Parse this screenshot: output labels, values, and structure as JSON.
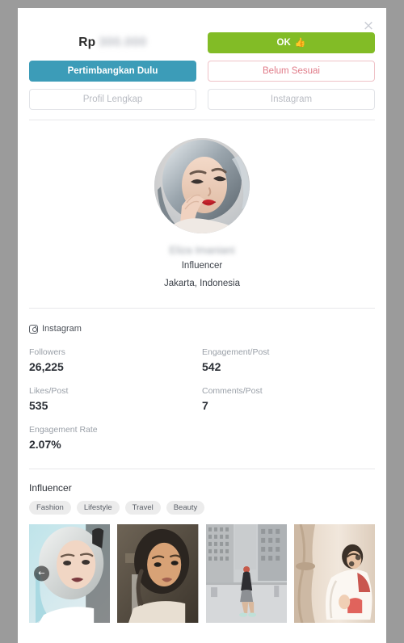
{
  "modal": {
    "close_label": "×"
  },
  "actions": {
    "price_currency": "Rp",
    "price_amount_redacted": "300.000",
    "ok_label": "OK",
    "ok_icon": "thumbs-up-icon",
    "consider_label": "Pertimbangkan Dulu",
    "reject_label": "Belum Sesuai",
    "full_profile_label": "Profil Lengkap",
    "instagram_label": "Instagram"
  },
  "profile": {
    "name_redacted": "Eliza Imaniani",
    "role": "Influencer",
    "location": "Jakarta, Indonesia",
    "avatar_alt": "influencer-portrait"
  },
  "platform": {
    "icon": "instagram-icon",
    "name": "Instagram"
  },
  "stats": [
    {
      "label": "Followers",
      "value": "26,225"
    },
    {
      "label": "Engagement/Post",
      "value": "542"
    },
    {
      "label": "Likes/Post",
      "value": "535"
    },
    {
      "label": "Comments/Post",
      "value": "7"
    },
    {
      "label": "Engagement Rate",
      "value": "2.07%"
    }
  ],
  "categories": {
    "heading": "Influencer",
    "tags": [
      "Fashion",
      "Lifestyle",
      "Travel",
      "Beauty"
    ]
  },
  "gallery": {
    "prev_icon": "←",
    "items": [
      {
        "alt": "portrait-silver-hair-white-top"
      },
      {
        "alt": "portrait-dark-warm-tone"
      },
      {
        "alt": "street-style-city-buildings"
      },
      {
        "alt": "indoor-curtain-white-blouse"
      }
    ]
  },
  "colors": {
    "accent_green": "#82bc26",
    "accent_teal": "#3c9cb8",
    "accent_pink": "#e07b88",
    "muted": "#b9bcc3"
  }
}
